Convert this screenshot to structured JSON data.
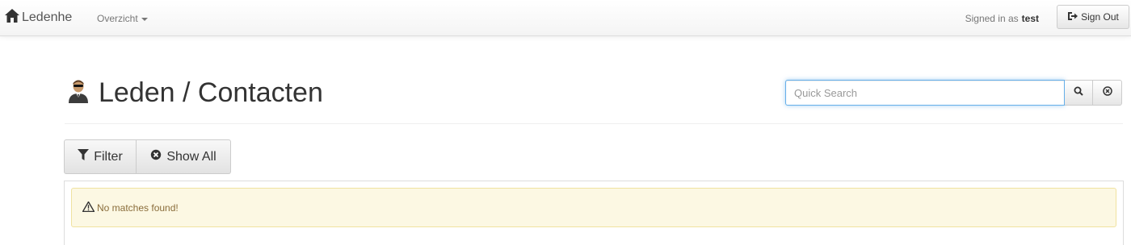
{
  "navbar": {
    "brand_label": "Ledenhe",
    "brand_icon": "home-icon",
    "menu_label": "Overzicht",
    "signed_in_prefix": "Signed in as",
    "username": "test",
    "signout_label": "Sign Out",
    "signout_icon": "sign-out-icon"
  },
  "header": {
    "title": "Leden / Contacten",
    "title_icon": "user-agent-icon"
  },
  "search": {
    "placeholder": "Quick Search",
    "value": "",
    "search_icon": "search-icon",
    "clear_icon": "clear-icon"
  },
  "toolbar": {
    "filter_label": "Filter",
    "filter_icon": "filter-icon",
    "show_all_label": "Show All",
    "show_all_icon": "remove-circle-icon"
  },
  "results": {
    "message": "No matches found!",
    "message_icon": "warning-icon"
  },
  "colors": {
    "alert_background": "#fcf8e3",
    "alert_text": "#8a6d3b",
    "focus_border": "#66afe9"
  }
}
